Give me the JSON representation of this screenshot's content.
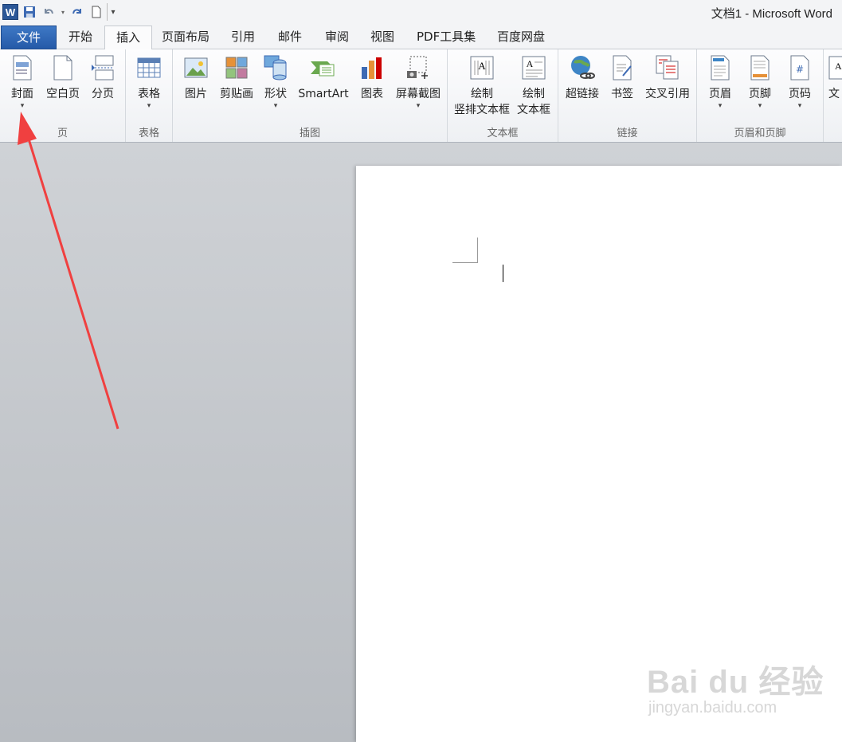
{
  "titlebar": {
    "app_icon": "W",
    "title": "文档1 - Microsoft Word"
  },
  "tabs": [
    {
      "label": "文件"
    },
    {
      "label": "开始"
    },
    {
      "label": "插入"
    },
    {
      "label": "页面布局"
    },
    {
      "label": "引用"
    },
    {
      "label": "邮件"
    },
    {
      "label": "审阅"
    },
    {
      "label": "视图"
    },
    {
      "label": "PDF工具集"
    },
    {
      "label": "百度网盘"
    }
  ],
  "ribbon": {
    "groups": {
      "pages": {
        "label": "页",
        "cover": "封面",
        "blank": "空白页",
        "break": "分页"
      },
      "tables": {
        "label": "表格",
        "table": "表格"
      },
      "illustrations": {
        "label": "插图",
        "picture": "图片",
        "clipart": "剪贴画",
        "shapes": "形状",
        "smartart": "SmartArt",
        "chart": "图表",
        "screenshot": "屏幕截图"
      },
      "textbox": {
        "label": "文本框",
        "vertical_1": "绘制",
        "vertical_2": "竖排文本框",
        "draw_1": "绘制",
        "draw_2": "文本框"
      },
      "links": {
        "label": "链接",
        "hyperlink": "超链接",
        "bookmark": "书签",
        "crossref": "交叉引用"
      },
      "header_footer": {
        "label": "页眉和页脚",
        "header": "页眉",
        "footer": "页脚",
        "pagenum": "页码"
      },
      "text": {
        "partial": "文"
      }
    }
  },
  "watermark": {
    "main": "Bai du 经验",
    "sub": "jingyan.baidu.com"
  },
  "colors": {
    "file_tab": "#2b5797",
    "annotation_arrow": "#f04040"
  }
}
